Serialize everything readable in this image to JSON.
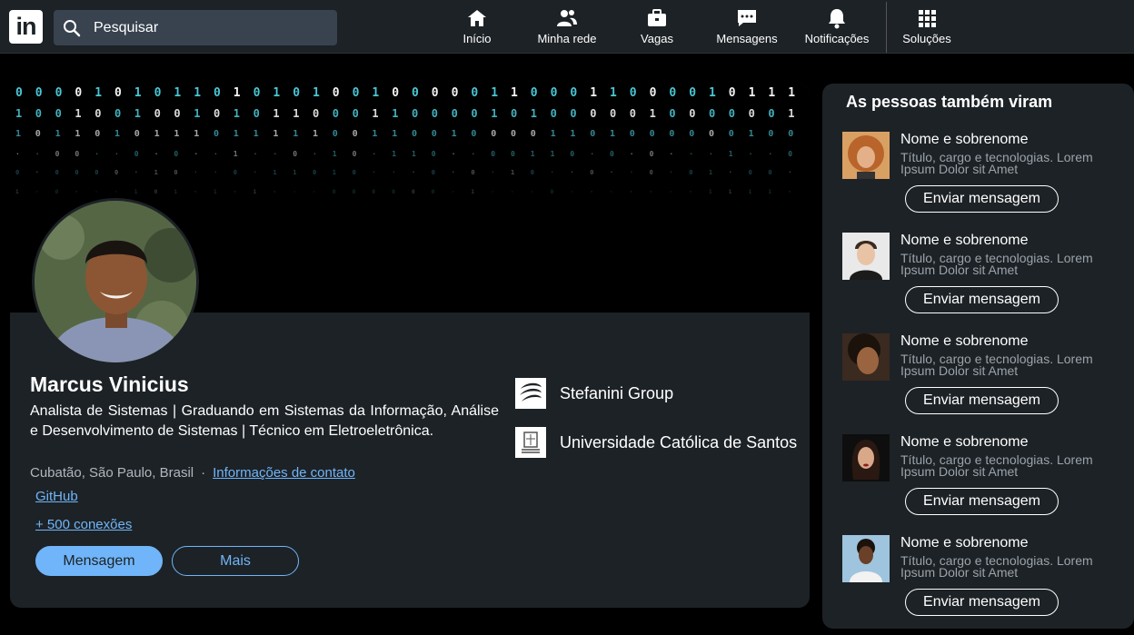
{
  "nav": {
    "logo": "in",
    "search_placeholder": "Pesquisar",
    "items": [
      {
        "label": "Início",
        "icon": "home-icon"
      },
      {
        "label": "Minha rede",
        "icon": "network-icon"
      },
      {
        "label": "Vagas",
        "icon": "briefcase-icon"
      },
      {
        "label": "Mensagens",
        "icon": "message-icon"
      },
      {
        "label": "Notificações",
        "icon": "bell-icon"
      },
      {
        "label": "Soluções",
        "icon": "grid-icon"
      }
    ]
  },
  "profile": {
    "name": "Marcus Vinicius",
    "headline": "Analista de Sistemas | Graduando em Sistemas da Informação, Análise e Desenvolvimento de Sistemas | Técnico em Eletroeletrônica.",
    "location": "Cubatão, São Paulo, Brasil",
    "separator": "·",
    "contact_link": "Informações de contato",
    "github_link": "GitHub",
    "connections": "+ 500 conexões",
    "message_button": "Mensagem",
    "more_button": "Mais",
    "organizations": [
      {
        "name": "Stefanini Group"
      },
      {
        "name": "Universidade Católica de Santos"
      }
    ]
  },
  "sidebar": {
    "title": "As pessoas também viram",
    "people": [
      {
        "name": "Nome e sobrenome",
        "desc": "Título, cargo e tecnologias. Lorem Ipsum Dolor sit Amet",
        "button": "Enviar mensagem"
      },
      {
        "name": "Nome e sobrenome",
        "desc": "Título, cargo e tecnologias. Lorem Ipsum Dolor sit Amet",
        "button": "Enviar mensagem"
      },
      {
        "name": "Nome e sobrenome",
        "desc": "Título, cargo e tecnologias. Lorem Ipsum Dolor sit Amet",
        "button": "Enviar mensagem"
      },
      {
        "name": "Nome e sobrenome",
        "desc": "Título, cargo e tecnologias. Lorem Ipsum Dolor sit Amet",
        "button": "Enviar mensagem"
      },
      {
        "name": "Nome e sobrenome",
        "desc": "Título, cargo e tecnologias. Lorem Ipsum Dolor sit Amet",
        "button": "Enviar mensagem"
      }
    ]
  },
  "colors": {
    "accent": "#70b5f9",
    "surface": "#1d2226",
    "banner_digits": "#4fd1e0"
  }
}
